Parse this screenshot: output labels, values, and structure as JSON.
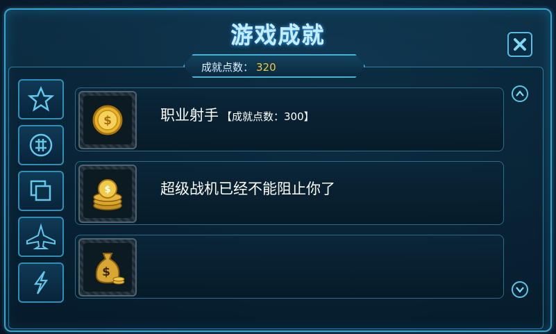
{
  "window": {
    "title": "游戏成就"
  },
  "points": {
    "label": "成就点数：",
    "value": "320"
  },
  "sidebar": {
    "tabs": [
      {
        "icon": "star-icon"
      },
      {
        "icon": "coin-icon"
      },
      {
        "icon": "copy-icon"
      },
      {
        "icon": "aircraft-icon"
      },
      {
        "icon": "lightning-icon"
      }
    ]
  },
  "achievements": [
    {
      "icon": "gold-coin-icon",
      "name": "职业射手",
      "points_label": "【成就点数：300】"
    },
    {
      "icon": "coin-stack-icon",
      "name": "超级战机已经不能阻止你了",
      "points_label": ""
    },
    {
      "icon": "money-bag-icon",
      "name": "",
      "points_label": ""
    }
  ],
  "colors": {
    "accent": "#3aa6cf",
    "gold": "#f3c93a"
  }
}
